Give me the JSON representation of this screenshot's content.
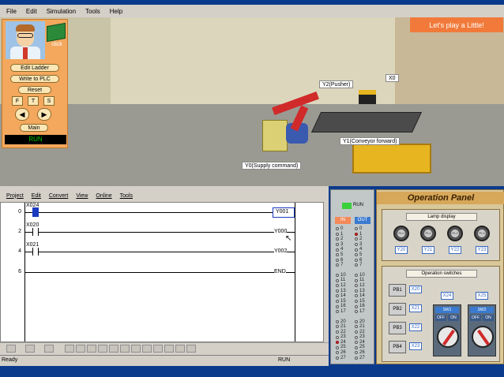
{
  "menubar": {
    "items": [
      "File",
      "Edit",
      "Simulation",
      "Tools",
      "Help"
    ]
  },
  "scene": {
    "banner": "Let's play a Little!",
    "labels": {
      "y2": "Y2(Pusher)",
      "x0": "X0",
      "y1": "Y1(Conveyor forward)",
      "y0": "Y0(Supply command)"
    }
  },
  "control_panel": {
    "click_label": "click",
    "edit_ladder": "Edit Ladder",
    "write_plc": "Write to PLC",
    "reset": "Reset",
    "f_btn": "F",
    "t_btn": "T",
    "s_btn": "S",
    "main": "Main",
    "run_status": "RUN"
  },
  "ladder": {
    "menu": [
      "Project",
      "Edit",
      "Convert",
      "View",
      "Online",
      "Tools"
    ],
    "rungs": [
      {
        "num": "0",
        "contact": "X024",
        "coil": "Y001"
      },
      {
        "num": "2",
        "contact": "X020",
        "coil": "Y000"
      },
      {
        "num": "4",
        "contact": "X021",
        "coil": "Y002"
      },
      {
        "num": "6",
        "contact": "",
        "coil": "END"
      }
    ],
    "status_left": "Ready",
    "status_mode": "RUN"
  },
  "plc": {
    "run_label": "RUN",
    "in_label": "IN",
    "out_label": "OUT",
    "in_groups": [
      [
        "0",
        "1",
        "2",
        "3",
        "4",
        "5",
        "6",
        "7"
      ],
      [
        "10",
        "11",
        "12",
        "13",
        "14",
        "15",
        "16",
        "17"
      ],
      [
        "20",
        "21",
        "22",
        "23",
        "24",
        "25",
        "26",
        "27"
      ]
    ],
    "out_groups": [
      [
        "0",
        "1",
        "2",
        "3",
        "4",
        "5",
        "6",
        "7"
      ],
      [
        "10",
        "11",
        "12",
        "13",
        "14",
        "15",
        "16",
        "17"
      ],
      [
        "20",
        "21",
        "22",
        "23",
        "24",
        "25",
        "26",
        "27"
      ]
    ],
    "in_on": [
      "24"
    ],
    "out_on": [
      "1"
    ]
  },
  "operation_panel": {
    "title": "Operation Panel",
    "lamp_header": "Lamp display",
    "lamps": [
      {
        "label": "PL0",
        "tag": "Y20"
      },
      {
        "label": "PL1",
        "tag": "Y21"
      },
      {
        "label": "PL2",
        "tag": "Y22"
      },
      {
        "label": "PL3",
        "tag": "Y23"
      }
    ],
    "switch_header": "Operation switches",
    "pushbuttons": [
      {
        "label": "PB1",
        "tag": "X20"
      },
      {
        "label": "PB2",
        "tag": "X21"
      },
      {
        "label": "PB3",
        "tag": "X22"
      },
      {
        "label": "PB4",
        "tag": "X23"
      }
    ],
    "switches": [
      {
        "name": "SW1",
        "tag": "X24",
        "off": "OFF",
        "on": "ON"
      },
      {
        "name": "SW2",
        "tag": "X25",
        "off": "OFF",
        "on": "ON"
      }
    ]
  }
}
